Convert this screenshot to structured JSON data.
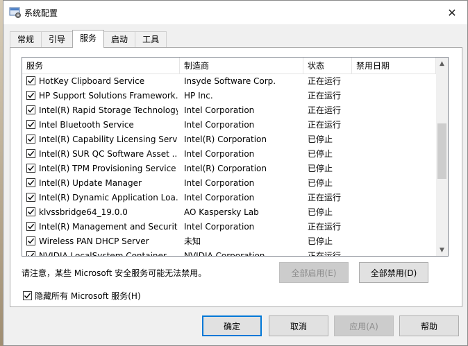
{
  "window": {
    "title": "系统配置",
    "close_glyph": "✕",
    "icon": "msconfig-icon"
  },
  "tabs": [
    {
      "label": "常规"
    },
    {
      "label": "引导"
    },
    {
      "label": "服务",
      "active": true
    },
    {
      "label": "启动"
    },
    {
      "label": "工具"
    }
  ],
  "services": {
    "columns": {
      "name": "服务",
      "manufacturer": "制造商",
      "status": "状态",
      "disabled_date": "禁用日期"
    },
    "rows": [
      {
        "checked": true,
        "name": "HotKey Clipboard Service",
        "manufacturer": "Insyde Software Corp.",
        "status": "正在运行"
      },
      {
        "checked": true,
        "name": "HP Support Solutions Framework...",
        "manufacturer": "HP Inc.",
        "status": "正在运行"
      },
      {
        "checked": true,
        "name": "Intel(R) Rapid Storage Technology",
        "manufacturer": "Intel Corporation",
        "status": "正在运行"
      },
      {
        "checked": true,
        "name": "Intel Bluetooth Service",
        "manufacturer": "Intel Corporation",
        "status": "正在运行"
      },
      {
        "checked": true,
        "name": "Intel(R) Capability Licensing Servi...",
        "manufacturer": "Intel(R) Corporation",
        "status": "已停止"
      },
      {
        "checked": true,
        "name": "Intel(R) SUR QC Software Asset ...",
        "manufacturer": "Intel Corporation",
        "status": "已停止"
      },
      {
        "checked": true,
        "name": "Intel(R) TPM Provisioning Service",
        "manufacturer": "Intel(R) Corporation",
        "status": "已停止"
      },
      {
        "checked": true,
        "name": "Intel(R) Update Manager",
        "manufacturer": "Intel Corporation",
        "status": "已停止"
      },
      {
        "checked": true,
        "name": "Intel(R) Dynamic Application Loa...",
        "manufacturer": "Intel Corporation",
        "status": "正在运行"
      },
      {
        "checked": true,
        "name": "klvssbridge64_19.0.0",
        "manufacturer": "AO Kaspersky Lab",
        "status": "已停止"
      },
      {
        "checked": true,
        "name": "Intel(R) Management and Securit...",
        "manufacturer": "Intel Corporation",
        "status": "正在运行"
      },
      {
        "checked": true,
        "name": "Wireless PAN DHCP Server",
        "manufacturer": "未知",
        "status": "已停止"
      },
      {
        "checked": true,
        "name": "NVIDIA LocalSystem Container",
        "manufacturer": "NVIDIA Corporation",
        "status": "正在运行"
      }
    ]
  },
  "note": "请注意，某些 Microsoft 安全服务可能无法禁用。",
  "buttons": {
    "enable_all": "全部启用(E)",
    "disable_all": "全部禁用(D)",
    "ok": "确定",
    "cancel": "取消",
    "apply": "应用(A)",
    "help": "帮助"
  },
  "hide_ms": {
    "label": "隐藏所有 Microsoft 服务(H)",
    "checked": true
  }
}
